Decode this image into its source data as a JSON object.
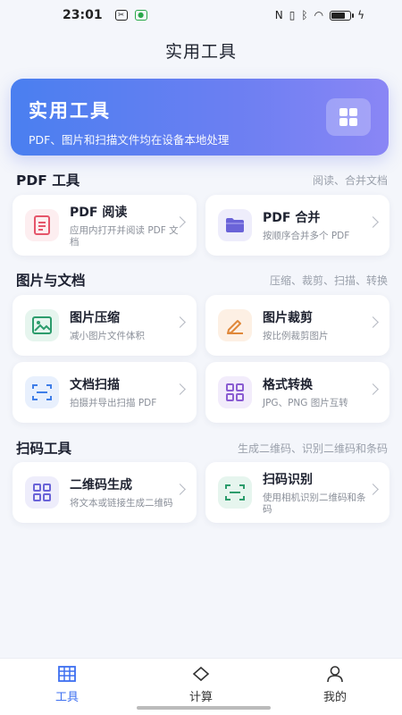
{
  "status": {
    "time": "23:01",
    "battery_level": 0.75
  },
  "app_title": "实用工具",
  "hero": {
    "title": "实用工具",
    "subtitle": "PDF、图片和扫描文件均在设备本地处理"
  },
  "sections": [
    {
      "title": "PDF 工具",
      "hint": "阅读、合并文档",
      "items": [
        {
          "title": "PDF 阅读",
          "desc": "应用内打开并阅读 PDF 文档",
          "icon": "document-icon",
          "color": "#e5556a",
          "bg": "#fdeef0"
        },
        {
          "title": "PDF 合并",
          "desc": "按顺序合并多个 PDF",
          "icon": "folder-icon",
          "color": "#6a63d8",
          "bg": "#eeedfb"
        }
      ]
    },
    {
      "title": "图片与文档",
      "hint": "压缩、裁剪、扫描、转换",
      "items": [
        {
          "title": "图片压缩",
          "desc": "减小图片文件体积",
          "icon": "image-icon",
          "color": "#2c9c6c",
          "bg": "#e6f5ee"
        },
        {
          "title": "图片裁剪",
          "desc": "按比例裁剪图片",
          "icon": "pencil-icon",
          "color": "#e0883a",
          "bg": "#fdf0e4"
        },
        {
          "title": "文档扫描",
          "desc": "拍摄并导出扫描 PDF",
          "icon": "scan-icon",
          "color": "#3f7ee8",
          "bg": "#e8f0fd"
        },
        {
          "title": "格式转换",
          "desc": "JPG、PNG 图片互转",
          "icon": "grid-icon",
          "color": "#8a5cd2",
          "bg": "#f2ecfb"
        }
      ]
    },
    {
      "title": "扫码工具",
      "hint": "生成二维码、识别二维码和条码",
      "items": [
        {
          "title": "二维码生成",
          "desc": "将文本或链接生成二维码",
          "icon": "qr-grid-icon",
          "color": "#6a63d8",
          "bg": "#eeedfb"
        },
        {
          "title": "扫码识别",
          "desc": "使用相机识别二维码和条码",
          "icon": "scan-frame-icon",
          "color": "#2c9c6c",
          "bg": "#e6f5ee"
        }
      ]
    }
  ],
  "tabs": [
    {
      "label": "工具",
      "icon": "grid-table-icon",
      "active": true
    },
    {
      "label": "计算",
      "icon": "diamond-icon",
      "active": false
    },
    {
      "label": "我的",
      "icon": "person-icon",
      "active": false
    }
  ],
  "colors": {
    "accent": "#3d6ff0",
    "background": "#f4f6fb"
  }
}
